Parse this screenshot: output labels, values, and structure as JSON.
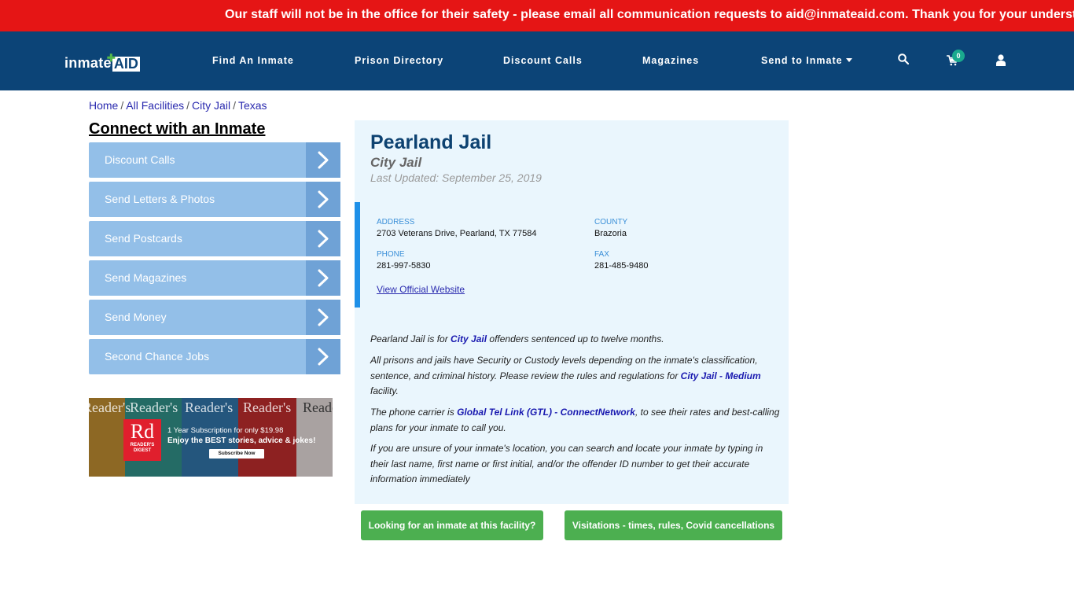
{
  "alert": {
    "text": "Our staff will not be in the office for their safety - please email all communication requests to aid@inmateaid.com. Thank you for your understanding."
  },
  "nav": {
    "logo_part1": "inmate",
    "logo_part2": "AID",
    "links": [
      {
        "label": "Find An Inmate"
      },
      {
        "label": "Prison Directory"
      },
      {
        "label": "Discount Calls"
      },
      {
        "label": "Magazines"
      },
      {
        "label": "Send to Inmate"
      }
    ],
    "cart_count": "0",
    "icons": [
      "search-icon",
      "cart-icon",
      "user-icon"
    ]
  },
  "breadcrumb": [
    {
      "label": "Home"
    },
    {
      "label": "All Facilities"
    },
    {
      "label": "City Jail"
    },
    {
      "label": "Texas"
    }
  ],
  "breadcrumb_sep": "/",
  "sidebar": {
    "title": "Connect with an Inmate",
    "items": [
      {
        "label": "Discount Calls"
      },
      {
        "label": "Send Letters & Photos"
      },
      {
        "label": "Send Postcards"
      },
      {
        "label": "Send Magazines"
      },
      {
        "label": "Send Money"
      },
      {
        "label": "Second Chance Jobs"
      }
    ],
    "ad": {
      "brand_big": "Rd",
      "brand_small1": "READER'S",
      "brand_small2": "DIGEST",
      "masthead": "Reader's",
      "line1": "1 Year Subscription for only $19.98",
      "line2": "Enjoy the BEST stories, advice & jokes!",
      "button": "Subscribe Now"
    }
  },
  "facility": {
    "name": "Pearland Jail",
    "type": "City Jail",
    "updated": "Last Updated: September 25, 2019",
    "address_label": "ADDRESS",
    "address": "2703 Veterans Drive, Pearland, TX 77584",
    "county_label": "COUNTY",
    "county": "Brazoria",
    "phone_label": "PHONE",
    "phone": "281-997-5830",
    "fax_label": "FAX",
    "fax": "281-485-9480",
    "website_link": "View Official Website"
  },
  "description": {
    "p1_a": "Pearland Jail is for ",
    "p1_link": "City Jail",
    "p1_b": " offenders sentenced up to twelve months.",
    "p2_a": "All prisons and jails have Security or Custody levels depending on the inmate's classification, sentence, and criminal history. Please review the rules and regulations for ",
    "p2_link": "City Jail - Medium",
    "p2_b": " facility.",
    "p3_a": "The phone carrier is ",
    "p3_link": "Global Tel Link (GTL) - ConnectNetwork",
    "p3_b": ", to see their rates and best-calling plans for your inmate to call you.",
    "p4": "If you are unsure of your inmate's location, you can search and locate your inmate by typing in their last name, first name or first initial, and/or the offender ID number to get their accurate information immediately"
  },
  "actions": {
    "find_inmate": "Looking for an inmate at this facility?",
    "visitation": "Visitations - times, rules, Covid cancellations"
  },
  "colors": {
    "alert_bg": "#e51515",
    "nav_bg": "#0c4477",
    "sidebar_item": "#93bfe8",
    "sidebar_arrow": "#6fa2d6",
    "card_bg": "#eaf6fd",
    "accent_blue": "#1e90e8",
    "button_green": "#4caf50",
    "badge_teal": "#1aaa8e"
  }
}
